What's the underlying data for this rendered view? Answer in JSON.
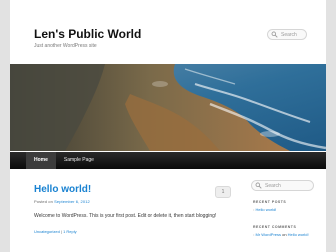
{
  "site": {
    "title": "Len's Public World",
    "tagline": "Just another WordPress site"
  },
  "search": {
    "top_placeholder": "Search",
    "side_placeholder": "Search"
  },
  "nav": {
    "items": [
      {
        "label": "Home"
      },
      {
        "label": "Sample Page"
      }
    ]
  },
  "post": {
    "title": "Hello world!",
    "comment_count": "1",
    "meta_prefix": "Posted on ",
    "meta_date": "September 6, 2012",
    "body": "Welcome to WordPress. This is your first post. Edit or delete it, then start blogging!",
    "category": "Uncategorized",
    "foot_sep": " | ",
    "reply": "1 Reply"
  },
  "sidebar": {
    "recent_posts_title": "RECENT POSTS",
    "recent_posts": [
      "Hello world!"
    ],
    "recent_comments_title": "RECENT COMMENTS",
    "comment_author": "Mr WordPress",
    "comment_on": " on ",
    "comment_post": "Hello world!"
  }
}
